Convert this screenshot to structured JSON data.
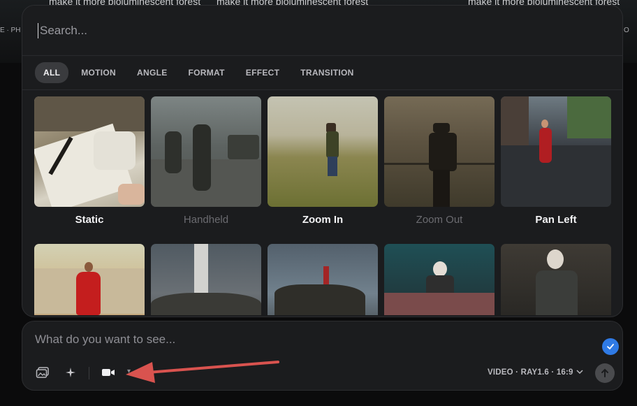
{
  "background": {
    "prompt_texts": [
      "make it more bioluminescent forest",
      "make it more bioluminescent forest",
      "make it more bioluminescent forest"
    ],
    "left_edge_text": "E · PH",
    "right_edge_text": "O"
  },
  "search": {
    "placeholder": "Search..."
  },
  "tabs": [
    {
      "label": "ALL",
      "active": true
    },
    {
      "label": "MOTION"
    },
    {
      "label": "ANGLE"
    },
    {
      "label": "FORMAT"
    },
    {
      "label": "EFFECT"
    },
    {
      "label": "TRANSITION"
    }
  ],
  "cards": [
    {
      "label": "Static",
      "dim": false
    },
    {
      "label": "Handheld",
      "dim": true
    },
    {
      "label": "Zoom In",
      "dim": false
    },
    {
      "label": "Zoom Out",
      "dim": true
    },
    {
      "label": "Pan Left",
      "dim": false
    }
  ],
  "prompt": {
    "placeholder": "What do you want to see...",
    "model_label": "VIDEO · RAY1.6 · 16:9"
  },
  "colors": {
    "accent_blue": "#2f7ae5",
    "annotation_arrow": "#d9534f"
  },
  "icons": [
    "image-icon",
    "sparkle-icon",
    "video-camera-icon",
    "chevron-down-icon",
    "check-icon",
    "arrow-up-icon"
  ]
}
